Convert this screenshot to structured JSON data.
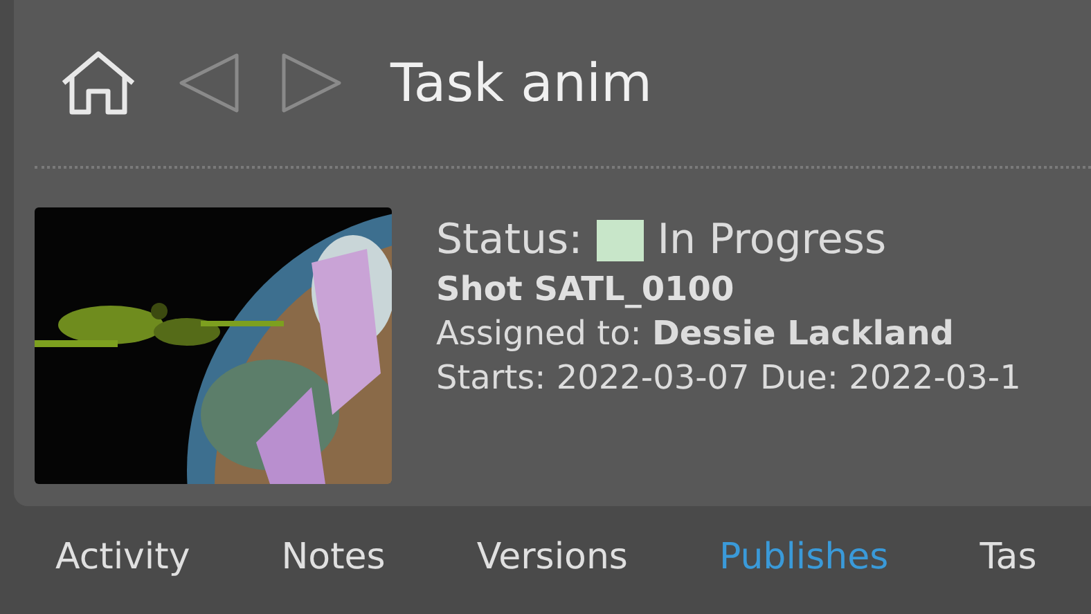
{
  "header": {
    "title": "Task anim"
  },
  "details": {
    "status": {
      "label": "Status:",
      "value": "In Progress",
      "color": "#c8e6c9"
    },
    "entity": "Shot SATL_0100",
    "assigned": "Assigned to: **Dessie Lackland**",
    "dates": "Starts: 2022-03-07 Due: 2022-03-1"
  },
  "tabs": [
    {
      "label": "Activity",
      "selected": false
    },
    {
      "label": "Notes",
      "selected": false
    },
    {
      "label": "Versions",
      "selected": false
    },
    {
      "label": "Publishes",
      "selected": true
    },
    {
      "label": "Tas",
      "selected": false
    }
  ]
}
